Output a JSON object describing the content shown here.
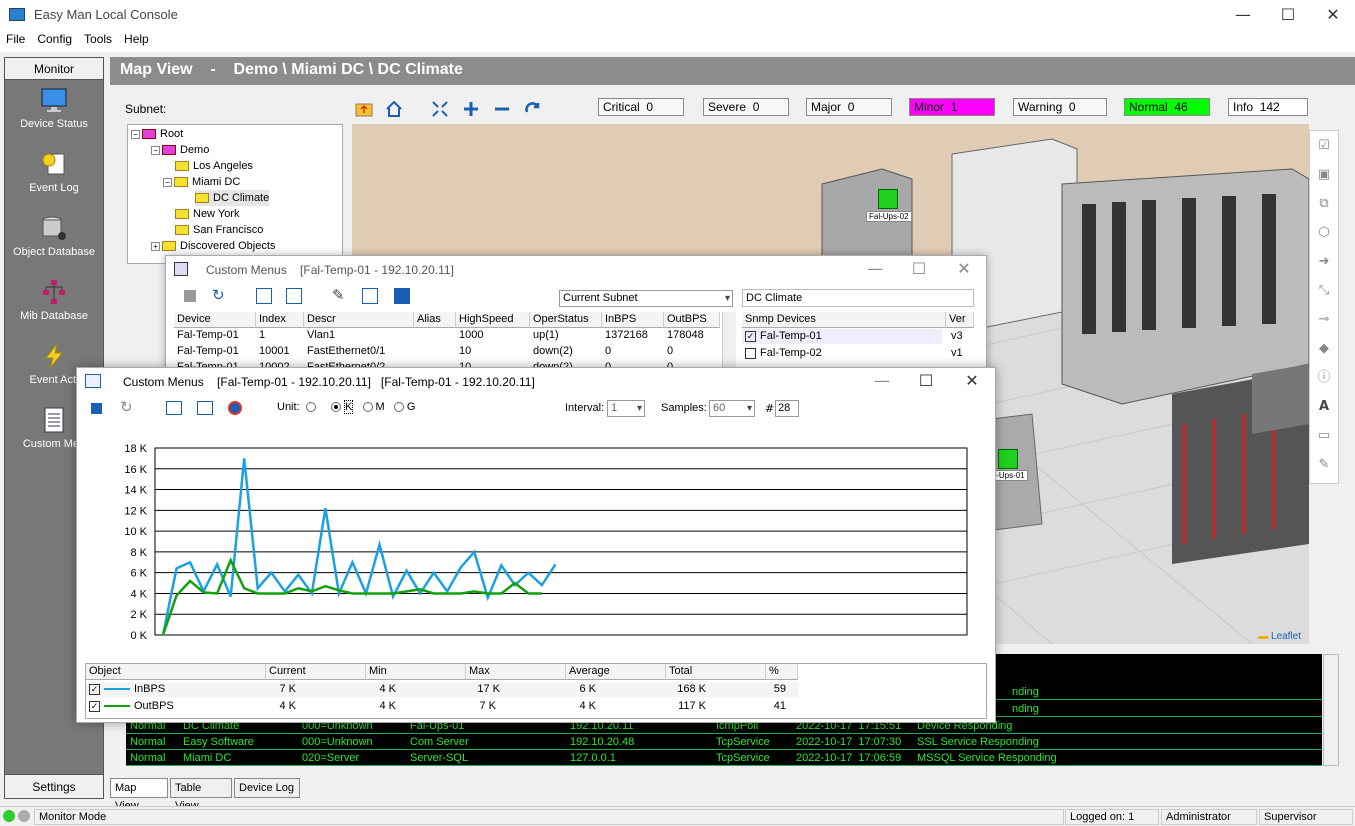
{
  "app": {
    "title": "Easy Man Local Console"
  },
  "menu": [
    "File",
    "Config",
    "Tools",
    "Help"
  ],
  "sidebar": {
    "header": "Monitor",
    "footer": "Settings",
    "items": [
      {
        "label": "Device Status",
        "icon": "monitor-icon"
      },
      {
        "label": "Event Log",
        "icon": "event-log-icon"
      },
      {
        "label": "Object Database",
        "icon": "database-icon"
      },
      {
        "label": "Mib Database",
        "icon": "mib-tree-icon"
      },
      {
        "label": "Event Acti",
        "icon": "lightning-icon"
      },
      {
        "label": "Custom Men",
        "icon": "document-icon"
      }
    ]
  },
  "header": {
    "title": "Map View    -    Demo \\ Miami DC \\ DC Climate"
  },
  "subnet_label": "Subnet:",
  "status_counts": [
    {
      "label": "Critical",
      "count": "0",
      "color": "#f8f8f8"
    },
    {
      "label": "Severe",
      "count": "0",
      "color": "#f8f8f8"
    },
    {
      "label": "Major",
      "count": "0",
      "color": "#f8f8f8"
    },
    {
      "label": "Minor",
      "count": "1",
      "color": "#ff00ff"
    },
    {
      "label": "Warning",
      "count": "0",
      "color": "#f8f8f8"
    },
    {
      "label": "Normal",
      "count": "46",
      "color": "#00ff00"
    },
    {
      "label": "Info",
      "count": "142",
      "color": "#ffffff"
    }
  ],
  "tree": [
    "Root",
    "Demo",
    "Los Angeles",
    "Miami DC",
    "DC Climate",
    "New York",
    "San Francisco",
    "Discovered Objects"
  ],
  "map": {
    "device_labels": [
      "Fal-Ups-02",
      "al-Ups-01"
    ],
    "attribution": "Leaflet"
  },
  "event_rows": [
    [
      "Normal",
      "DC Climate",
      "000=Unknown",
      "Fal-Ups-01",
      "192.10.20.11",
      "IcmpPoll",
      "2022-10-17  17:15:51",
      "Device Responding"
    ],
    [
      "Normal",
      "Easy Software",
      "000=Unknown",
      "Com Server",
      "192.10.20.48",
      "TcpService",
      "2022-10-17  17:07:30",
      "SSL Service Responding"
    ],
    [
      "Normal",
      "Miami DC",
      "020=Server",
      "Server-SQL",
      "127.0.0.1",
      "TcpService",
      "2022-10-17  17:06:59",
      "MSSQL Service Responding"
    ]
  ],
  "event_partial": [
    "nding",
    "nding"
  ],
  "tabs": [
    "Map View",
    "Table View",
    "Device Log"
  ],
  "statusbar": {
    "mode": "Monitor Mode",
    "logged_on": "Logged on: 1",
    "user": "Administrator",
    "role": "Supervisor"
  },
  "win1": {
    "title": "Custom Menus",
    "subtitle": "[Fal-Temp-01 - 192.10.20.11]",
    "subnet_select": "Current Subnet",
    "group_field": "DC Climate",
    "columns": [
      "Device",
      "Index",
      "Descr",
      "Alias",
      "HighSpeed",
      "OperStatus",
      "InBPS",
      "OutBPS"
    ],
    "rows": [
      [
        "Fal-Temp-01",
        "1",
        "Vlan1",
        "",
        "1000",
        "up(1)",
        "1372168",
        "178048"
      ],
      [
        "Fal-Temp-01",
        "10001",
        "FastEthernet0/1",
        "",
        "10",
        "down(2)",
        "0",
        "0"
      ],
      [
        "Fal-Temp-01",
        "10002",
        "FastEthernet0/2",
        "",
        "10",
        "down(2)",
        "0",
        "0"
      ]
    ],
    "snmp_header": [
      "Snmp Devices",
      "Ver"
    ],
    "snmp_rows": [
      {
        "name": "Fal-Temp-01",
        "ver": "v3",
        "checked": true
      },
      {
        "name": "Fal-Temp-02",
        "ver": "v1",
        "checked": false
      }
    ]
  },
  "win2": {
    "title": "Custom Menus",
    "subtitle": "[Fal-Temp-01 - 192.10.20.11]   [Fal-Temp-01 - 192.10.20.11]",
    "unit_label": "Unit:",
    "units": [
      "",
      "K",
      "M",
      "G"
    ],
    "unit_selected": "K",
    "interval_label": "Interval:",
    "interval_value": "1",
    "samples_label": "Samples:",
    "samples_value": "60",
    "count_label": "#",
    "count_value": "28",
    "stats_columns": [
      "Object",
      "Current",
      "Min",
      "Max",
      "Average",
      "Total",
      "%"
    ],
    "stats_rows": [
      {
        "name": "InBPS",
        "color": "#1ba1e2",
        "values": [
          "7 K",
          "4 K",
          "17 K",
          "6 K",
          "168 K",
          "59"
        ]
      },
      {
        "name": "OutBPS",
        "color": "#13a10e",
        "values": [
          "4 K",
          "4 K",
          "7 K",
          "4 K",
          "117 K",
          "41"
        ]
      }
    ]
  },
  "chart_data": {
    "type": "line",
    "title": "",
    "xlabel": "",
    "ylabel": "",
    "ylim": [
      0,
      18000
    ],
    "yticks": [
      "0 K",
      "2 K",
      "4 K",
      "6 K",
      "8 K",
      "10 K",
      "12 K",
      "14 K",
      "16 K",
      "18 K"
    ],
    "grid": true,
    "x": [
      1,
      2,
      3,
      4,
      5,
      6,
      7,
      8,
      9,
      10,
      11,
      12,
      13,
      14,
      15,
      16,
      17,
      18,
      19,
      20,
      21,
      22,
      23,
      24,
      25,
      26,
      27,
      28
    ],
    "series": [
      {
        "name": "InBPS",
        "color": "#1ba1e2",
        "values": [
          0,
          6400,
          7000,
          4200,
          6800,
          3700,
          17000,
          4500,
          6000,
          4200,
          5800,
          4000,
          12200,
          4000,
          7000,
          4000,
          8700,
          3700,
          6200,
          4000,
          6000,
          4200,
          6500,
          8000,
          3600,
          6700,
          4800,
          6000,
          4800,
          6800
        ]
      },
      {
        "name": "OutBPS",
        "color": "#13a10e",
        "values": [
          0,
          3800,
          5200,
          4100,
          4000,
          7200,
          4500,
          4000,
          4000,
          4000,
          4500,
          4200,
          4700,
          4300,
          4000,
          4000,
          4000,
          4000,
          4200,
          4400,
          4000,
          4000,
          4000,
          4200,
          4000,
          4000,
          5000,
          4000,
          4000
        ]
      }
    ]
  }
}
